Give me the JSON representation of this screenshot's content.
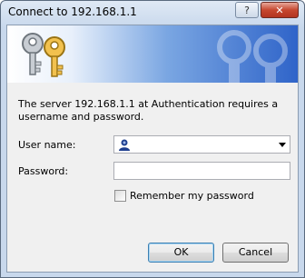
{
  "window": {
    "title": "Connect to 192.168.1.1",
    "help_label": "?",
    "close_label": "✕"
  },
  "banner": {
    "icon": "keys-icon",
    "watermark": "keys-watermark-icon",
    "gradient_start": "#ffffff",
    "gradient_end": "#2f64c9"
  },
  "message": "The server 192.168.1.1 at Authentication requires a username and password.",
  "form": {
    "username_label": "User name:",
    "username_value": "",
    "username_icon": "user-icon",
    "password_label": "Password:",
    "password_value": "",
    "remember_label": "Remember my password",
    "remember_checked": false
  },
  "buttons": {
    "ok_label": "OK",
    "cancel_label": "Cancel"
  }
}
